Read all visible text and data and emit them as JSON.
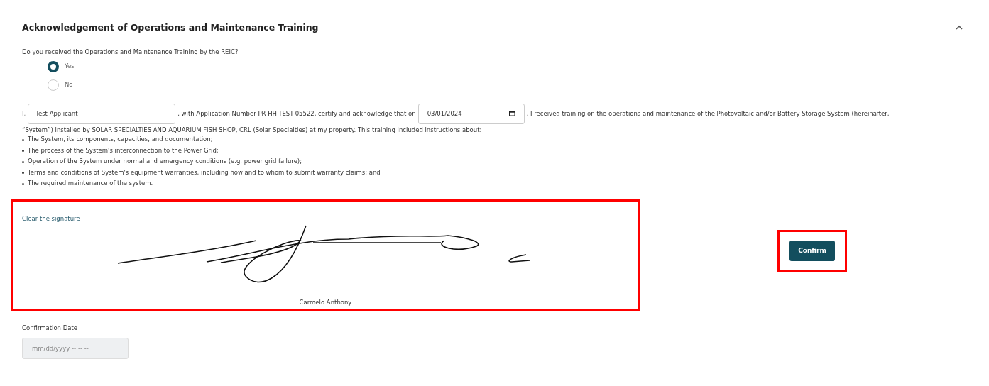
{
  "section": {
    "title": "Acknowledgement of Operations and Maintenance Training",
    "expanded": true
  },
  "question": {
    "label": "Do you received the Operations and Maintenance Training by the REIC?",
    "options": [
      {
        "label": "Yes",
        "selected": true
      },
      {
        "label": "No",
        "selected": false
      }
    ]
  },
  "statement": {
    "prefix": "I,",
    "name_field": {
      "value": "Test Applicant"
    },
    "text_a": ", with Application Number PR-HH-TEST-05522, certify and acknowledge that on",
    "date_field": {
      "value": "03/01/2024"
    },
    "text_b": ", I received training on the operations and maintenance of the Photovaltaic and/or Battery Storage System (hereinafter,",
    "text_c": "“System”) installed by SOLAR SPECIALTIES AND AQUARIUM FISH SHOP, CRL  (Solar Specialties) at my property. This training included instructions about:",
    "items": [
      "The System, its components, capacities, and documentation;",
      "The process of the System's interconnection to the Power Grid;",
      "Operation of the System under normal and emergency conditions (e.g. power grid failure);",
      "Terms and conditions of System's equipment warranties, including how and to whom to submit warranty claims; and",
      "The required maintenance of the system."
    ]
  },
  "signature": {
    "clear_link": "Clear the signature",
    "signer": "Carmelo Anthony"
  },
  "confirm_button": "Confirm",
  "confirmation_date": {
    "label": "Confirmation Date",
    "placeholder": "mm/dd/yyyy --:-- --",
    "disabled": true
  }
}
